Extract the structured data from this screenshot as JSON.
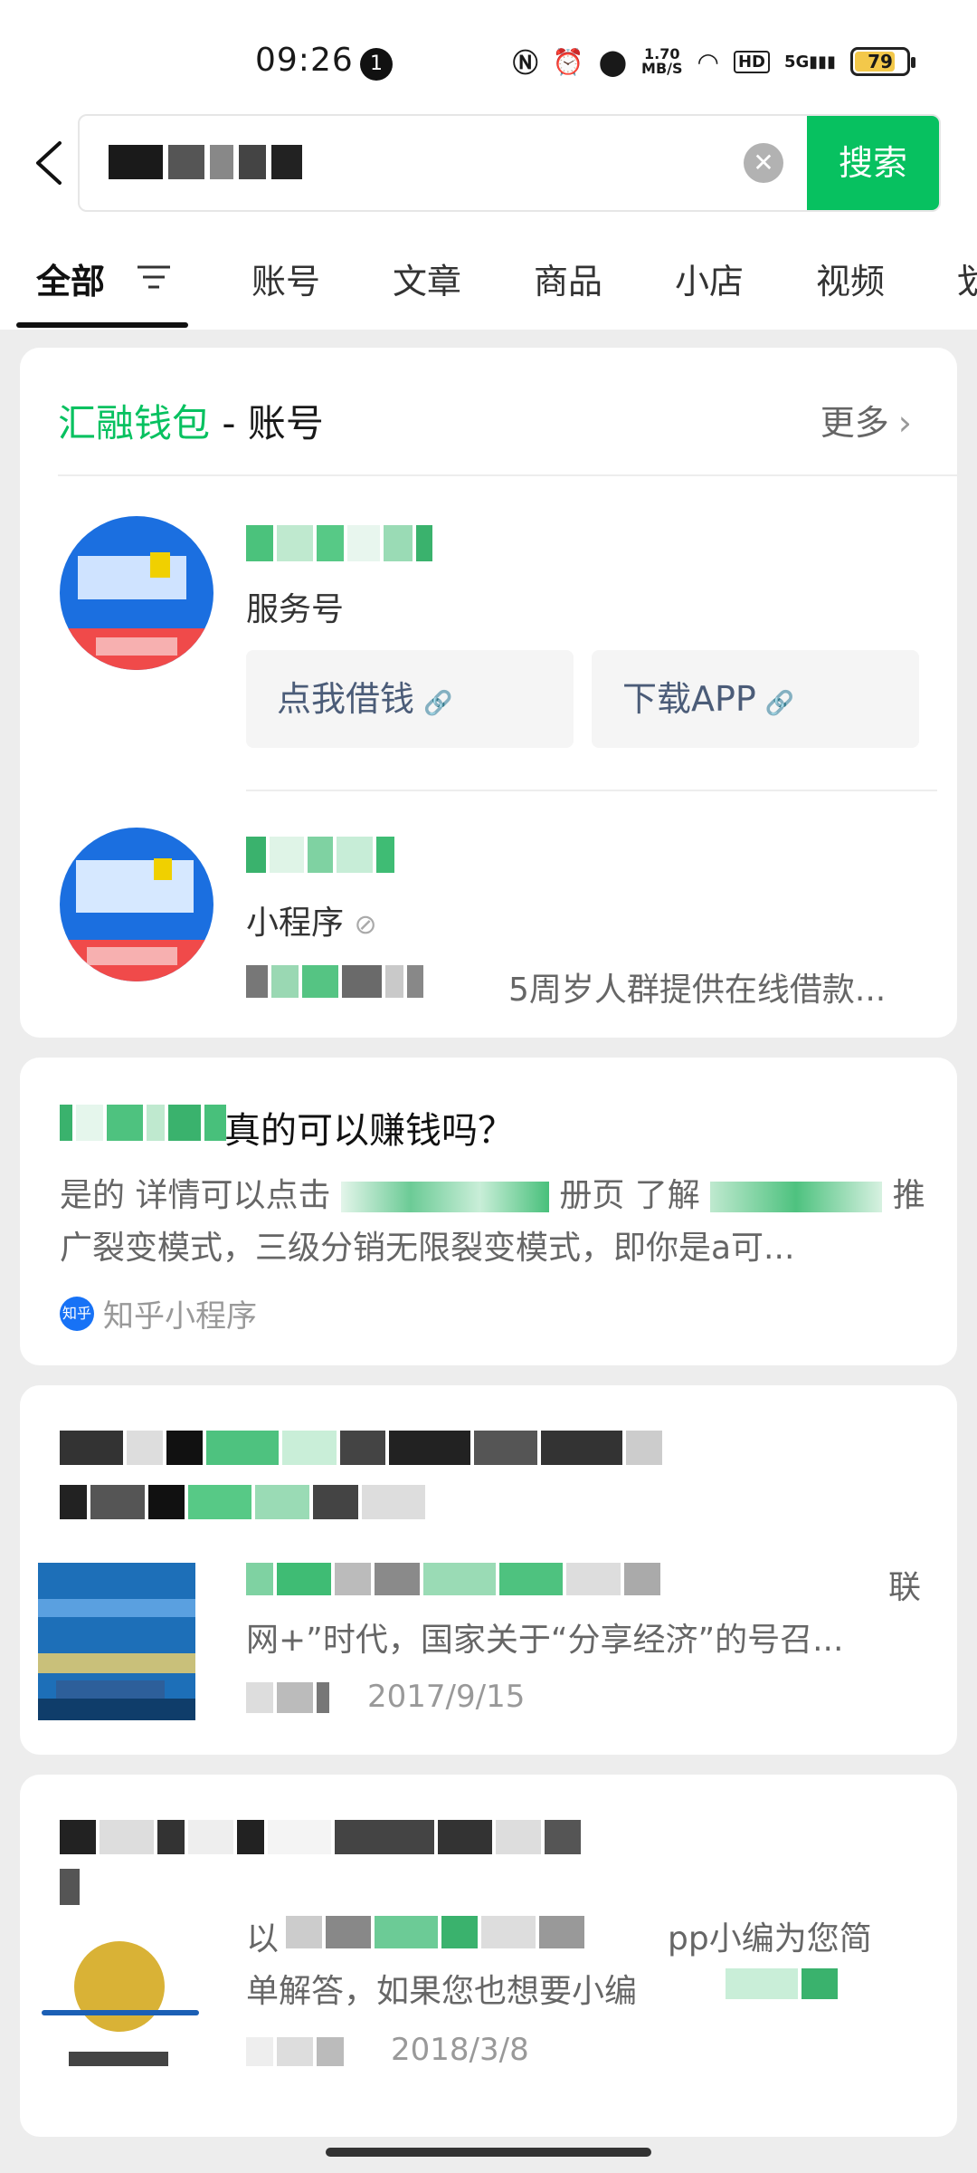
{
  "status_bar": {
    "time": "09:26",
    "notification_count": "1",
    "net_speed_value": "1.70",
    "net_speed_unit": "MB/S",
    "hd": "HD",
    "signal": "5G",
    "battery": "79"
  },
  "search": {
    "query": "",
    "button_label": "搜索"
  },
  "tabs": [
    {
      "label": "全部"
    },
    {
      "label": "账号"
    },
    {
      "label": "文章"
    },
    {
      "label": "商品"
    },
    {
      "label": "小店"
    },
    {
      "label": "视频"
    },
    {
      "label": "划"
    }
  ],
  "account_card": {
    "brand": "汇融钱包",
    "suffix": " - 账号",
    "more_label": "更多",
    "item1": {
      "type": "服务号",
      "chip1": "点我借钱",
      "chip2": "下载APP"
    },
    "item2": {
      "type": "小程序",
      "desc": "5周岁人群提供在线借款..."
    }
  },
  "qa_card": {
    "title": "真的可以赚钱吗？",
    "line1a": "是的 详情可以点击",
    "line1b": "册页 了解",
    "line1c": "推",
    "line2": "广裂变模式，三级分销无限裂变模式，即你是a可...",
    "source": "知乎小程序",
    "source_icon": "知乎"
  },
  "article1": {
    "desc_line1_tail": "联",
    "desc_line2": "网+”时代，国家关于“分享经济”的号召...",
    "date": "2017/9/15"
  },
  "article2": {
    "desc_line1a": "以",
    "desc_line1b": "pp小编为您简",
    "desc_line2": "单解答，如果您也想要小编",
    "date": "2018/3/8"
  }
}
